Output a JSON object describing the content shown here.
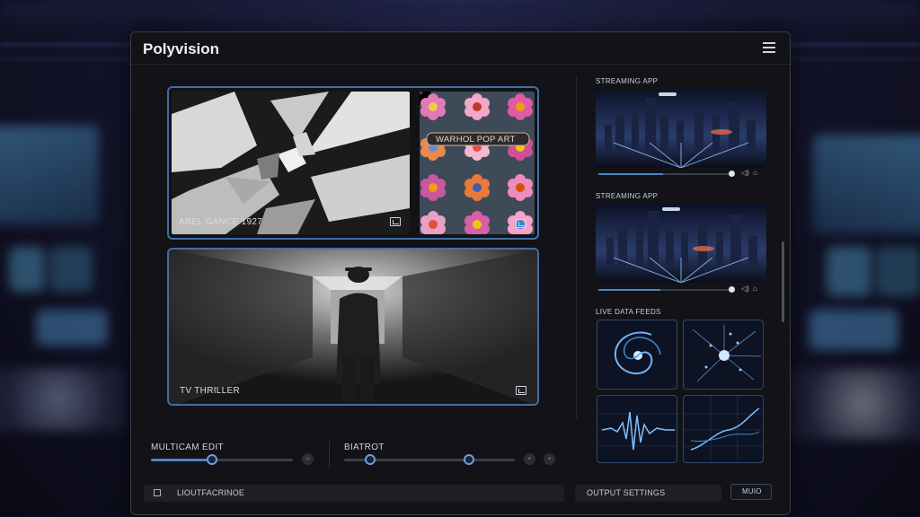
{
  "app": {
    "title": "Polyvision"
  },
  "tiles": {
    "abel": {
      "label": "ABEL GANCE 1927"
    },
    "warhol": {
      "label": "WARHOL POP ART"
    },
    "thriller": {
      "label": "TV THRILLER"
    }
  },
  "right_panel": {
    "streams": [
      {
        "label": "STREAMING APP",
        "progress": 0.48
      },
      {
        "label": "STREAMING APP",
        "progress": 0.46
      }
    ],
    "feeds_label": "LIVE DATA FEEDS"
  },
  "controls": {
    "multicam": {
      "label": "MULTICAM EDIT",
      "value": 0.42
    },
    "bitrate": {
      "label": "BIATROT",
      "values": [
        0.15,
        0.73
      ]
    }
  },
  "bottom": {
    "shortcut_label": "LIOUTFACRINOE",
    "output_settings": "OUTPUT SETTINGS",
    "mini_button": "MUIO"
  },
  "colors": {
    "accent": "#4a86c4",
    "tile_border": "#3f6fa5"
  }
}
